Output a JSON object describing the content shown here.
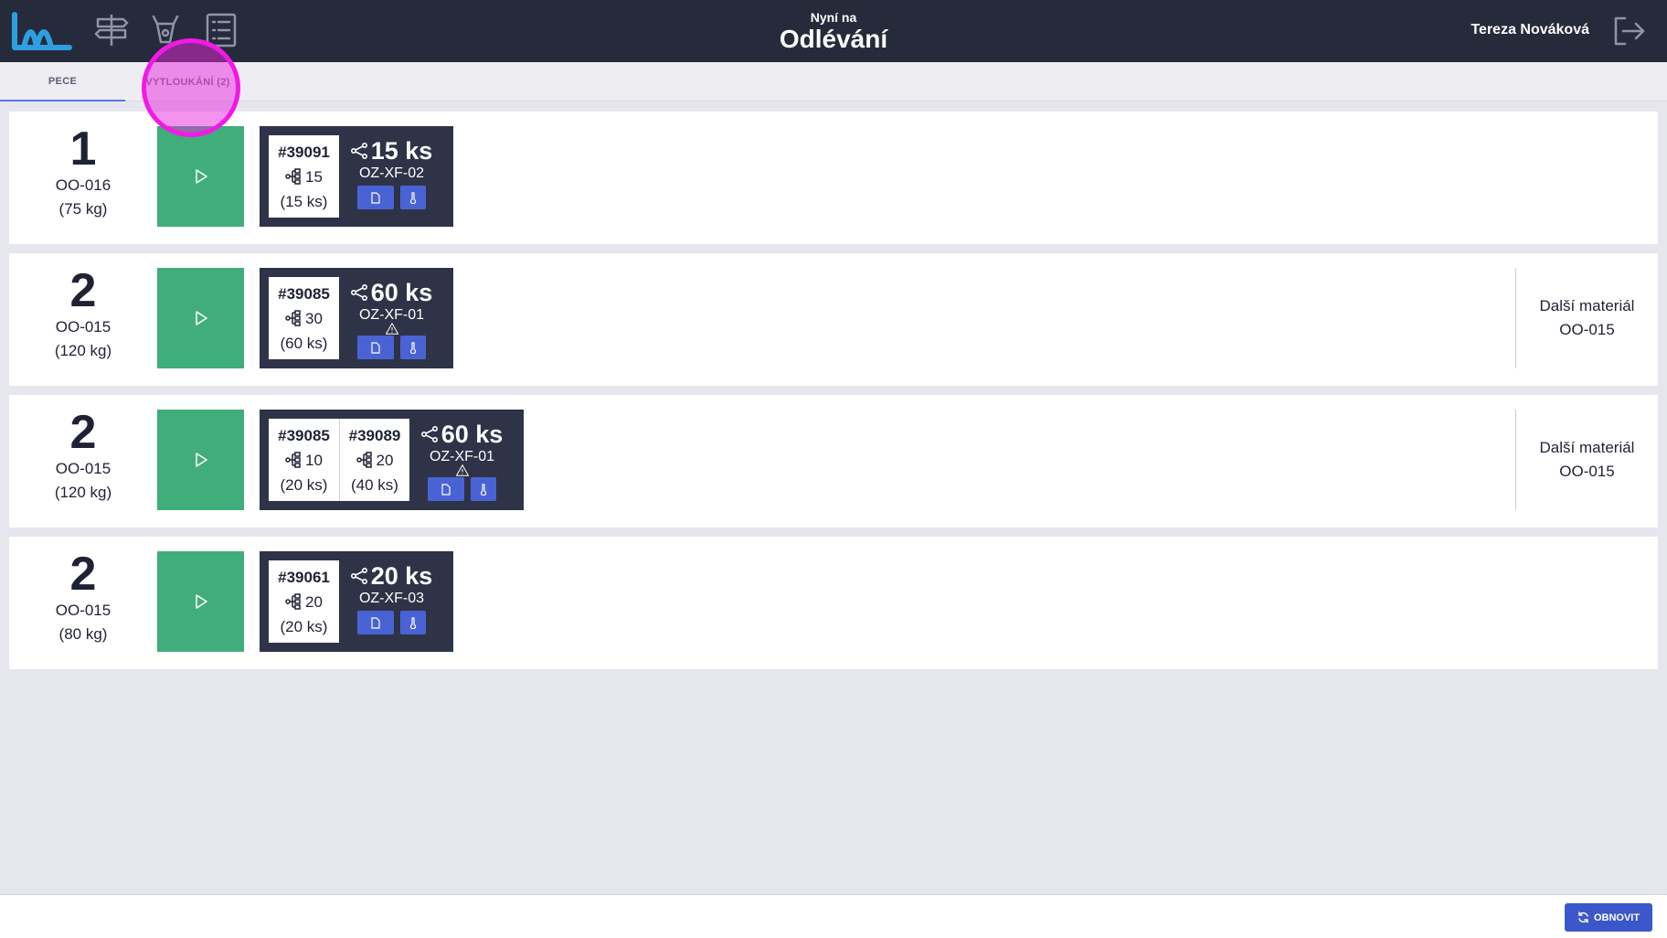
{
  "header": {
    "subtitle": "Nyní na",
    "title": "Odlévání",
    "user_name": "Tereza Nováková"
  },
  "tabs": [
    {
      "label": "PECE",
      "active": true
    },
    {
      "label": "VYTLOUKÁNÍ (2)",
      "active": false
    }
  ],
  "rows": [
    {
      "qty": "1",
      "material": "OO-016",
      "weight": "(75 kg)",
      "orders": [
        {
          "number": "#39091",
          "pieces": "15",
          "total": "(15 ks)"
        }
      ],
      "info": {
        "qty": "15 ks",
        "code": "OZ-XF-02",
        "warning": false
      },
      "next": null
    },
    {
      "qty": "2",
      "material": "OO-015",
      "weight": "(120 kg)",
      "orders": [
        {
          "number": "#39085",
          "pieces": "30",
          "total": "(60 ks)"
        }
      ],
      "info": {
        "qty": "60 ks",
        "code": "OZ-XF-01",
        "warning": true
      },
      "next": {
        "label": "Další materiál",
        "material": "OO-015"
      }
    },
    {
      "qty": "2",
      "material": "OO-015",
      "weight": "(120 kg)",
      "orders": [
        {
          "number": "#39085",
          "pieces": "10",
          "total": "(20 ks)"
        },
        {
          "number": "#39089",
          "pieces": "20",
          "total": "(40 ks)"
        }
      ],
      "info": {
        "qty": "60 ks",
        "code": "OZ-XF-01",
        "warning": true
      },
      "next": {
        "label": "Další materiál",
        "material": "OO-015"
      }
    },
    {
      "qty": "2",
      "material": "OO-015",
      "weight": "(80 kg)",
      "orders": [
        {
          "number": "#39061",
          "pieces": "20",
          "total": "(20 ks)"
        }
      ],
      "info": {
        "qty": "20 ks",
        "code": "OZ-XF-03",
        "warning": false
      },
      "next": null
    }
  ],
  "footer": {
    "refresh_label": "OBNOVIT"
  },
  "colors": {
    "topbar": "#262b3b",
    "accent_blue": "#4a63d4",
    "play_green": "#3fae7a",
    "logo_blue": "#2d9fe0",
    "highlight_magenta": "#f219e6"
  }
}
